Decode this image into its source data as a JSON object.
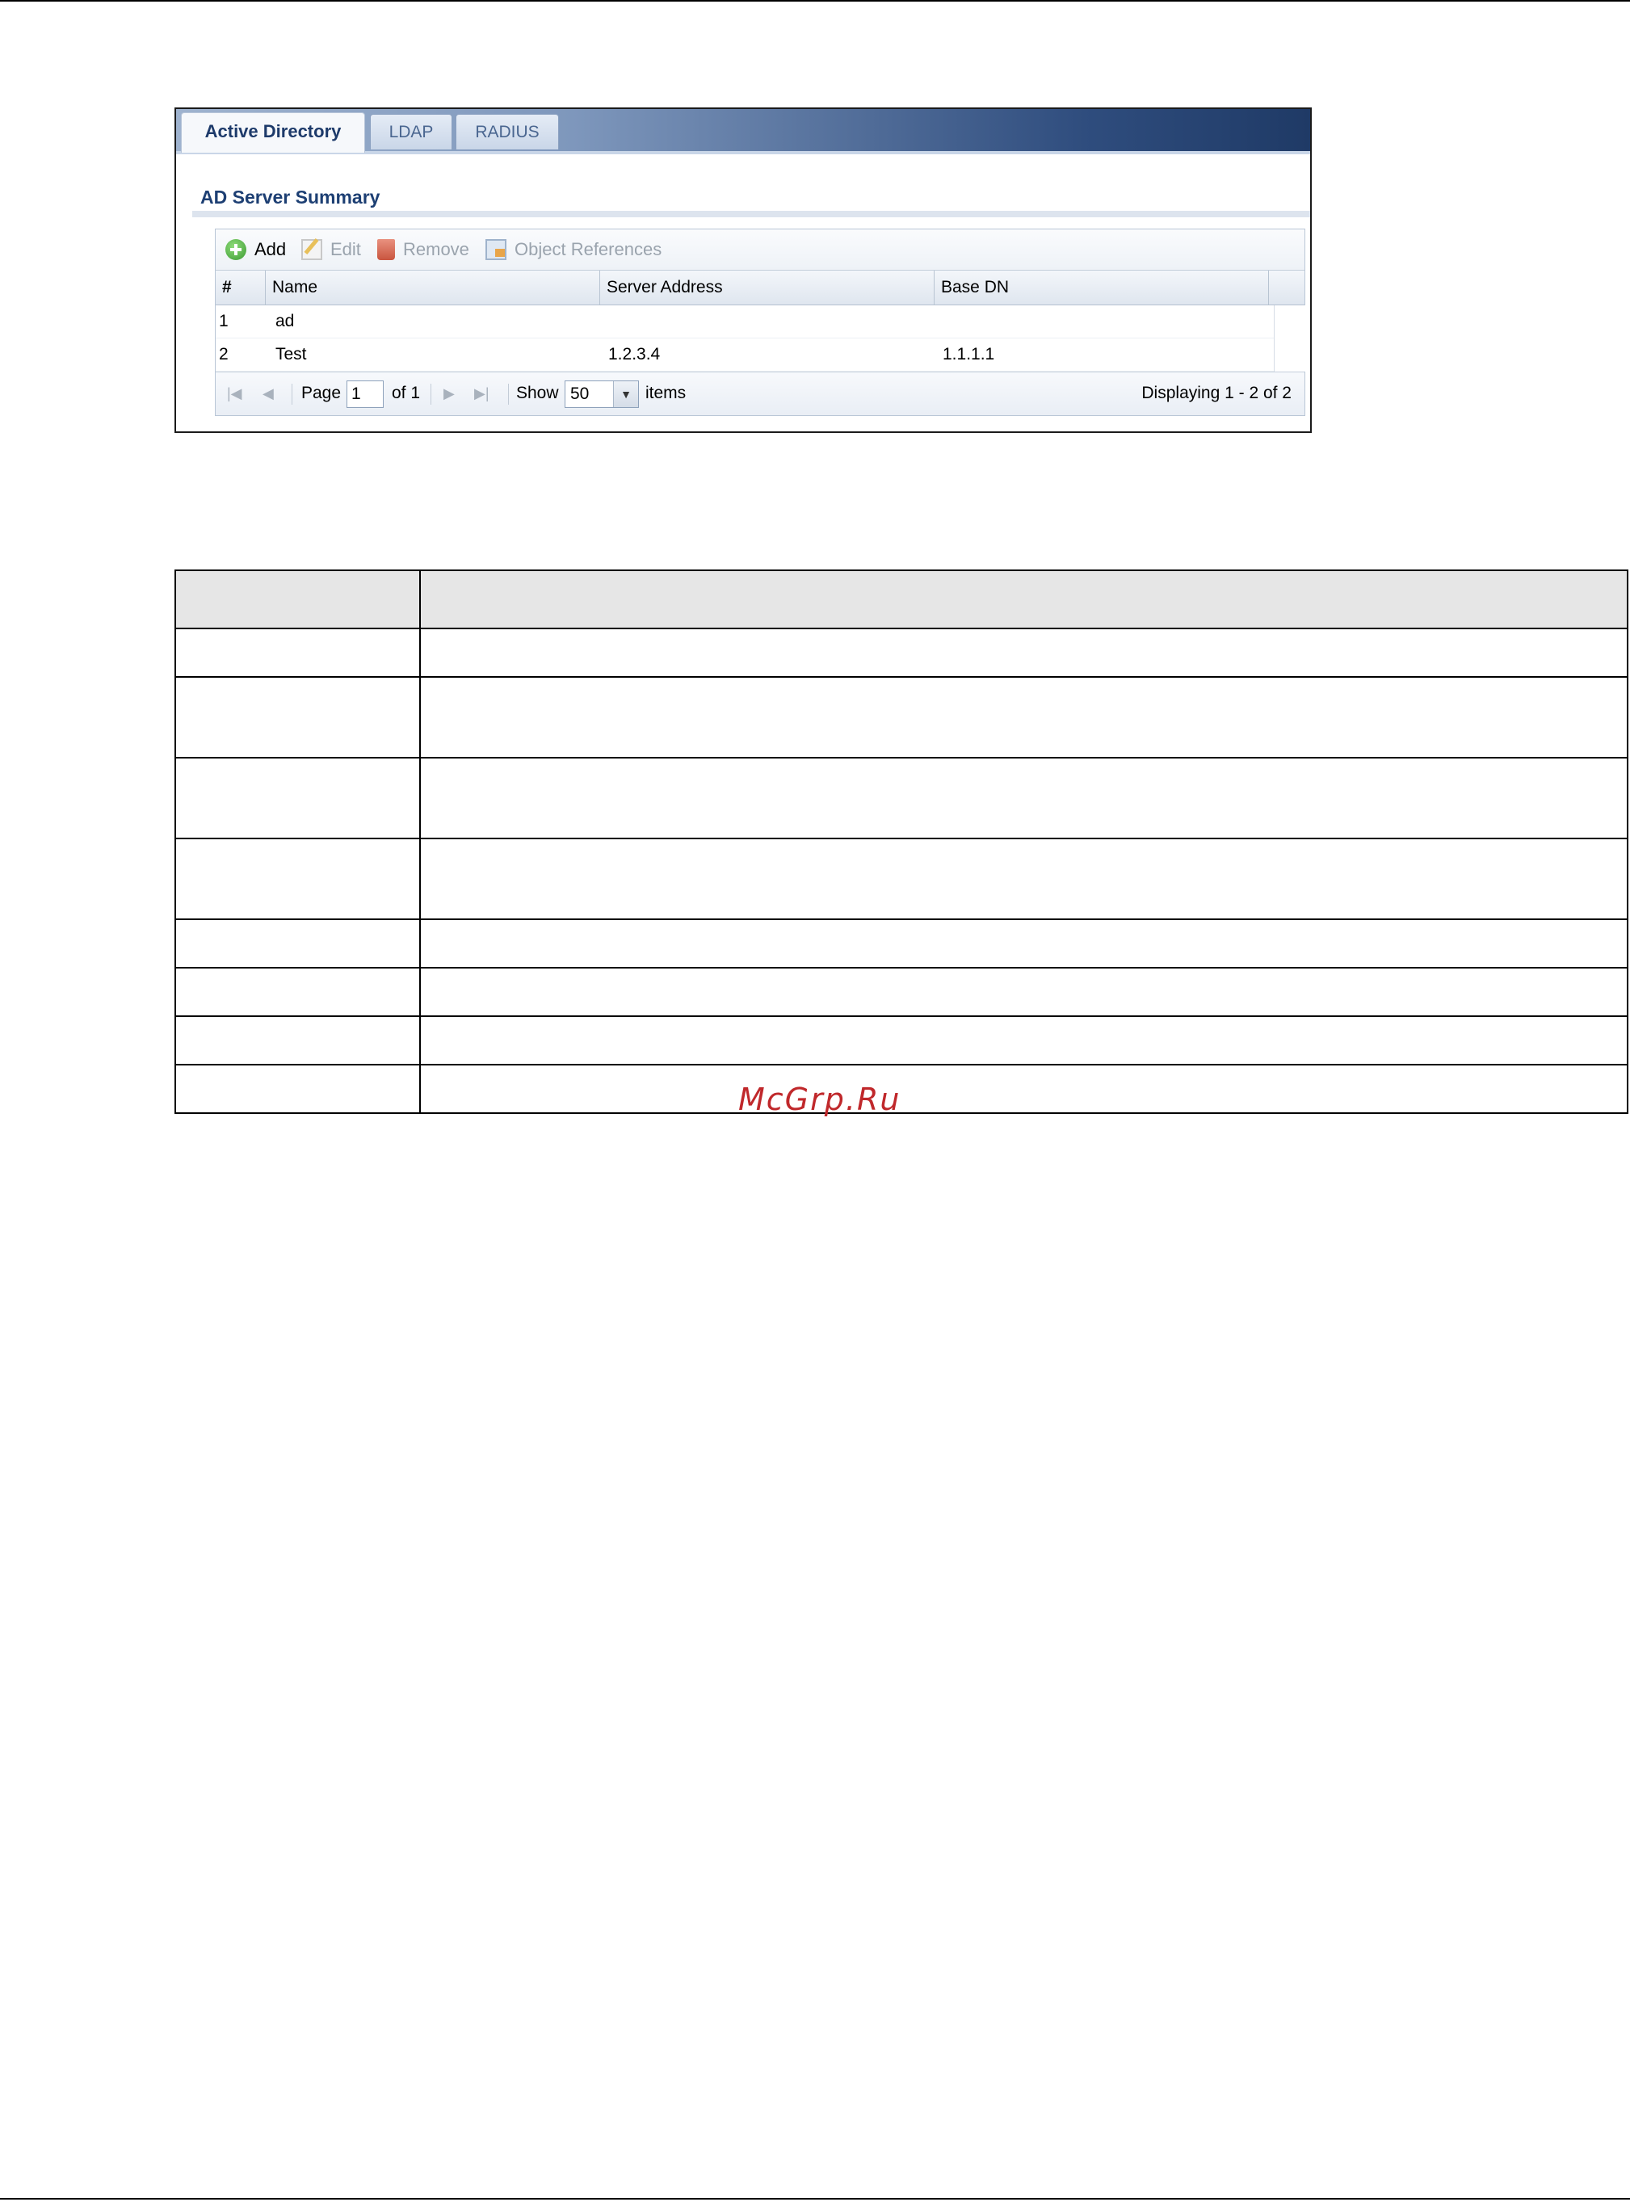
{
  "tabs": [
    {
      "label": "Active Directory",
      "active": true
    },
    {
      "label": "LDAP",
      "active": false
    },
    {
      "label": "RADIUS",
      "active": false
    }
  ],
  "section": {
    "title": "AD Server Summary"
  },
  "toolbar": {
    "add_label": "Add",
    "edit_label": "Edit",
    "remove_label": "Remove",
    "object_references_label": "Object References"
  },
  "grid": {
    "columns": [
      "#",
      "Name",
      "Server Address",
      "Base DN"
    ],
    "rows": [
      {
        "num": "1",
        "name": "ad",
        "server_address": "",
        "base_dn": ""
      },
      {
        "num": "2",
        "name": "Test",
        "server_address": "1.2.3.4",
        "base_dn": "1.1.1.1"
      }
    ]
  },
  "pager": {
    "page_label": "Page",
    "page_value": "1",
    "of_label": "of 1",
    "show_label": "Show",
    "show_value": "50",
    "items_label": "items",
    "displaying": "Displaying 1 - 2 of 2"
  },
  "icons": {
    "first_page": "first-page-icon",
    "prev_page": "prev-page-icon",
    "next_page": "next-page-icon",
    "last_page": "last-page-icon",
    "dropdown": "chevron-down-icon"
  },
  "watermark": "McGrp.Ru",
  "colors": {
    "tab_active_text": "#1d3a6a",
    "section_title": "#1d3f73",
    "watermark": "#c0282b"
  }
}
